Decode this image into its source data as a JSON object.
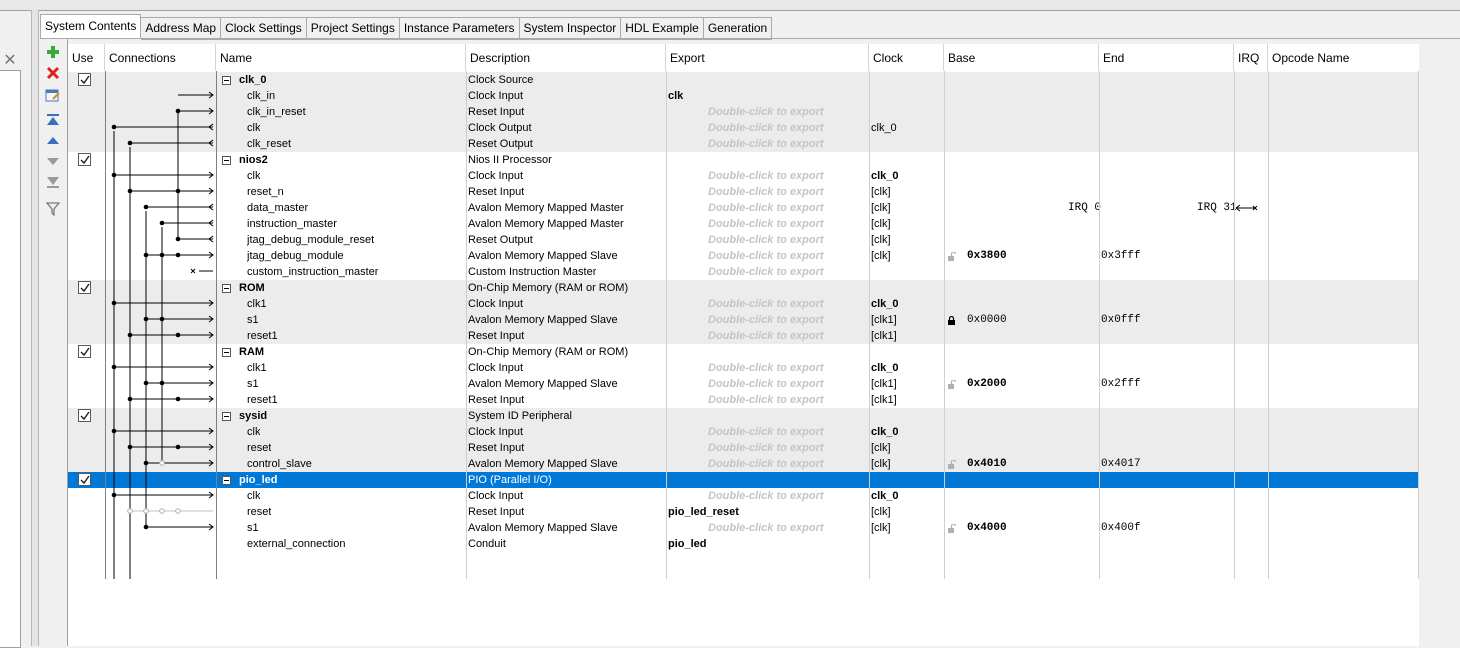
{
  "tabs": [
    {
      "label": "System Contents",
      "active": true
    },
    {
      "label": "Address Map",
      "active": false
    },
    {
      "label": "Clock Settings",
      "active": false
    },
    {
      "label": "Project Settings",
      "active": false
    },
    {
      "label": "Instance Parameters",
      "active": false
    },
    {
      "label": "System Inspector",
      "active": false
    },
    {
      "label": "HDL Example",
      "active": false
    },
    {
      "label": "Generation",
      "active": false
    }
  ],
  "toolbar": [
    "add-icon",
    "remove-icon",
    "edit-icon",
    "move-top-icon",
    "move-up-icon",
    "move-down-icon",
    "move-bottom-icon",
    "filter-icon"
  ],
  "columns": {
    "use": "Use",
    "connections": "Connections",
    "name": "Name",
    "description": "Description",
    "export": "Export",
    "clock": "Clock",
    "base": "Base",
    "end": "End",
    "irq": "IRQ",
    "opcode": "Opcode Name"
  },
  "export_hint": "Double-click to export",
  "rows": [
    {
      "type": "component",
      "checked": true,
      "name": "clk_0",
      "desc": "Clock Source",
      "export": "",
      "clock": "",
      "base": "",
      "end": "",
      "shade": true
    },
    {
      "type": "iface",
      "name": "clk_in",
      "desc": "Clock Input",
      "export": "clk",
      "clock": "",
      "base": "",
      "end": "",
      "shade": true
    },
    {
      "type": "iface",
      "name": "clk_in_reset",
      "desc": "Reset Input",
      "export": "",
      "clock": "",
      "base": "",
      "end": "",
      "shade": true
    },
    {
      "type": "iface",
      "name": "clk",
      "desc": "Clock Output",
      "export": "",
      "clock": "clk_0",
      "base": "",
      "end": "",
      "shade": true
    },
    {
      "type": "iface",
      "name": "clk_reset",
      "desc": "Reset Output",
      "export": "",
      "clock": "",
      "base": "",
      "end": "",
      "shade": true
    },
    {
      "type": "component",
      "checked": true,
      "name": "nios2",
      "desc": "Nios II Processor",
      "export": "",
      "clock": "",
      "base": "",
      "end": "",
      "shade": false
    },
    {
      "type": "iface",
      "name": "clk",
      "desc": "Clock Input",
      "export": "",
      "clock": "clk_0",
      "clock_bold": true,
      "base": "",
      "end": "",
      "shade": false
    },
    {
      "type": "iface",
      "name": "reset_n",
      "desc": "Reset Input",
      "export": "",
      "clock": "[clk]",
      "base": "",
      "end": "",
      "shade": false
    },
    {
      "type": "iface",
      "name": "data_master",
      "desc": "Avalon Memory Mapped Master",
      "export": "",
      "clock": "[clk]",
      "base": "",
      "end": "",
      "irq_left": "IRQ 0",
      "irq_right": "IRQ 31",
      "shade": false
    },
    {
      "type": "iface",
      "name": "instruction_master",
      "desc": "Avalon Memory Mapped Master",
      "export": "",
      "clock": "[clk]",
      "base": "",
      "end": "",
      "shade": false
    },
    {
      "type": "iface",
      "name": "jtag_debug_module_reset",
      "desc": "Reset Output",
      "export": "",
      "clock": "[clk]",
      "base": "",
      "end": "",
      "shade": false
    },
    {
      "type": "iface",
      "name": "jtag_debug_module",
      "desc": "Avalon Memory Mapped Slave",
      "export": "",
      "clock": "[clk]",
      "base": "0x3800",
      "base_bold": true,
      "lock": "open",
      "end": "0x3fff",
      "shade": false
    },
    {
      "type": "iface",
      "name": "custom_instruction_master",
      "desc": "Custom Instruction Master",
      "export": "",
      "clock": "",
      "base": "",
      "end": "",
      "shade": false
    },
    {
      "type": "component",
      "checked": true,
      "name": "ROM",
      "desc": "On-Chip Memory (RAM or ROM)",
      "export": "",
      "clock": "",
      "base": "",
      "end": "",
      "shade": true
    },
    {
      "type": "iface",
      "name": "clk1",
      "desc": "Clock Input",
      "export": "",
      "clock": "clk_0",
      "clock_bold": true,
      "base": "",
      "end": "",
      "shade": true
    },
    {
      "type": "iface",
      "name": "s1",
      "desc": "Avalon Memory Mapped Slave",
      "export": "",
      "clock": "[clk1]",
      "base": "0x0000",
      "base_bold": false,
      "lock": "closed",
      "end": "0x0fff",
      "shade": true
    },
    {
      "type": "iface",
      "name": "reset1",
      "desc": "Reset Input",
      "export": "",
      "clock": "[clk1]",
      "base": "",
      "end": "",
      "shade": true
    },
    {
      "type": "component",
      "checked": true,
      "name": "RAM",
      "desc": "On-Chip Memory (RAM or ROM)",
      "export": "",
      "clock": "",
      "base": "",
      "end": "",
      "shade": false
    },
    {
      "type": "iface",
      "name": "clk1",
      "desc": "Clock Input",
      "export": "",
      "clock": "clk_0",
      "clock_bold": true,
      "base": "",
      "end": "",
      "shade": false
    },
    {
      "type": "iface",
      "name": "s1",
      "desc": "Avalon Memory Mapped Slave",
      "export": "",
      "clock": "[clk1]",
      "base": "0x2000",
      "base_bold": true,
      "lock": "open",
      "end": "0x2fff",
      "shade": false
    },
    {
      "type": "iface",
      "name": "reset1",
      "desc": "Reset Input",
      "export": "",
      "clock": "[clk1]",
      "base": "",
      "end": "",
      "shade": false
    },
    {
      "type": "component",
      "checked": true,
      "name": "sysid",
      "desc": "System ID Peripheral",
      "export": "",
      "clock": "",
      "base": "",
      "end": "",
      "shade": true
    },
    {
      "type": "iface",
      "name": "clk",
      "desc": "Clock Input",
      "export": "",
      "clock": "clk_0",
      "clock_bold": true,
      "base": "",
      "end": "",
      "shade": true
    },
    {
      "type": "iface",
      "name": "reset",
      "desc": "Reset Input",
      "export": "",
      "clock": "[clk]",
      "base": "",
      "end": "",
      "shade": true
    },
    {
      "type": "iface",
      "name": "control_slave",
      "desc": "Avalon Memory Mapped Slave",
      "export": "",
      "clock": "[clk]",
      "base": "0x4010",
      "base_bold": true,
      "lock": "open",
      "end": "0x4017",
      "shade": true
    },
    {
      "type": "component",
      "checked": true,
      "name": "pio_led",
      "desc": "PIO (Parallel I/O)",
      "export": "",
      "clock": "",
      "base": "",
      "end": "",
      "selected": true
    },
    {
      "type": "iface",
      "name": "clk",
      "desc": "Clock Input",
      "export": "",
      "clock": "clk_0",
      "clock_bold": true,
      "base": "",
      "end": "",
      "shade": false
    },
    {
      "type": "iface",
      "name": "reset",
      "desc": "Reset Input",
      "export": "pio_led_reset",
      "clock": "[clk]",
      "base": "",
      "end": "",
      "shade": false
    },
    {
      "type": "iface",
      "name": "s1",
      "desc": "Avalon Memory Mapped Slave",
      "export": "",
      "clock": "[clk]",
      "base": "0x4000",
      "base_bold": true,
      "lock": "open",
      "end": "0x400f",
      "shade": false
    },
    {
      "type": "iface",
      "name": "external_connection",
      "desc": "Conduit",
      "export": "pio_led",
      "clock": "",
      "base": "",
      "end": "",
      "shade": false,
      "no_hint": true
    }
  ]
}
